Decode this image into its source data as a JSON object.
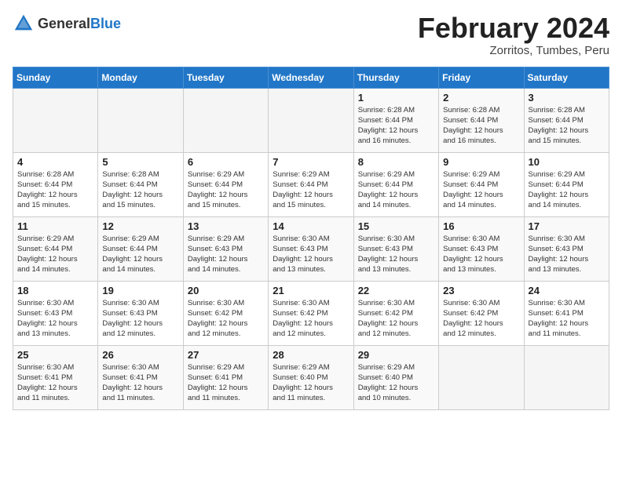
{
  "header": {
    "logo_general": "General",
    "logo_blue": "Blue",
    "month_year": "February 2024",
    "location": "Zorritos, Tumbes, Peru"
  },
  "weekdays": [
    "Sunday",
    "Monday",
    "Tuesday",
    "Wednesday",
    "Thursday",
    "Friday",
    "Saturday"
  ],
  "weeks": [
    [
      {
        "day": "",
        "info": ""
      },
      {
        "day": "",
        "info": ""
      },
      {
        "day": "",
        "info": ""
      },
      {
        "day": "",
        "info": ""
      },
      {
        "day": "1",
        "info": "Sunrise: 6:28 AM\nSunset: 6:44 PM\nDaylight: 12 hours\nand 16 minutes."
      },
      {
        "day": "2",
        "info": "Sunrise: 6:28 AM\nSunset: 6:44 PM\nDaylight: 12 hours\nand 16 minutes."
      },
      {
        "day": "3",
        "info": "Sunrise: 6:28 AM\nSunset: 6:44 PM\nDaylight: 12 hours\nand 15 minutes."
      }
    ],
    [
      {
        "day": "4",
        "info": "Sunrise: 6:28 AM\nSunset: 6:44 PM\nDaylight: 12 hours\nand 15 minutes."
      },
      {
        "day": "5",
        "info": "Sunrise: 6:28 AM\nSunset: 6:44 PM\nDaylight: 12 hours\nand 15 minutes."
      },
      {
        "day": "6",
        "info": "Sunrise: 6:29 AM\nSunset: 6:44 PM\nDaylight: 12 hours\nand 15 minutes."
      },
      {
        "day": "7",
        "info": "Sunrise: 6:29 AM\nSunset: 6:44 PM\nDaylight: 12 hours\nand 15 minutes."
      },
      {
        "day": "8",
        "info": "Sunrise: 6:29 AM\nSunset: 6:44 PM\nDaylight: 12 hours\nand 14 minutes."
      },
      {
        "day": "9",
        "info": "Sunrise: 6:29 AM\nSunset: 6:44 PM\nDaylight: 12 hours\nand 14 minutes."
      },
      {
        "day": "10",
        "info": "Sunrise: 6:29 AM\nSunset: 6:44 PM\nDaylight: 12 hours\nand 14 minutes."
      }
    ],
    [
      {
        "day": "11",
        "info": "Sunrise: 6:29 AM\nSunset: 6:44 PM\nDaylight: 12 hours\nand 14 minutes."
      },
      {
        "day": "12",
        "info": "Sunrise: 6:29 AM\nSunset: 6:44 PM\nDaylight: 12 hours\nand 14 minutes."
      },
      {
        "day": "13",
        "info": "Sunrise: 6:29 AM\nSunset: 6:43 PM\nDaylight: 12 hours\nand 14 minutes."
      },
      {
        "day": "14",
        "info": "Sunrise: 6:30 AM\nSunset: 6:43 PM\nDaylight: 12 hours\nand 13 minutes."
      },
      {
        "day": "15",
        "info": "Sunrise: 6:30 AM\nSunset: 6:43 PM\nDaylight: 12 hours\nand 13 minutes."
      },
      {
        "day": "16",
        "info": "Sunrise: 6:30 AM\nSunset: 6:43 PM\nDaylight: 12 hours\nand 13 minutes."
      },
      {
        "day": "17",
        "info": "Sunrise: 6:30 AM\nSunset: 6:43 PM\nDaylight: 12 hours\nand 13 minutes."
      }
    ],
    [
      {
        "day": "18",
        "info": "Sunrise: 6:30 AM\nSunset: 6:43 PM\nDaylight: 12 hours\nand 13 minutes."
      },
      {
        "day": "19",
        "info": "Sunrise: 6:30 AM\nSunset: 6:43 PM\nDaylight: 12 hours\nand 12 minutes."
      },
      {
        "day": "20",
        "info": "Sunrise: 6:30 AM\nSunset: 6:42 PM\nDaylight: 12 hours\nand 12 minutes."
      },
      {
        "day": "21",
        "info": "Sunrise: 6:30 AM\nSunset: 6:42 PM\nDaylight: 12 hours\nand 12 minutes."
      },
      {
        "day": "22",
        "info": "Sunrise: 6:30 AM\nSunset: 6:42 PM\nDaylight: 12 hours\nand 12 minutes."
      },
      {
        "day": "23",
        "info": "Sunrise: 6:30 AM\nSunset: 6:42 PM\nDaylight: 12 hours\nand 12 minutes."
      },
      {
        "day": "24",
        "info": "Sunrise: 6:30 AM\nSunset: 6:41 PM\nDaylight: 12 hours\nand 11 minutes."
      }
    ],
    [
      {
        "day": "25",
        "info": "Sunrise: 6:30 AM\nSunset: 6:41 PM\nDaylight: 12 hours\nand 11 minutes."
      },
      {
        "day": "26",
        "info": "Sunrise: 6:30 AM\nSunset: 6:41 PM\nDaylight: 12 hours\nand 11 minutes."
      },
      {
        "day": "27",
        "info": "Sunrise: 6:29 AM\nSunset: 6:41 PM\nDaylight: 12 hours\nand 11 minutes."
      },
      {
        "day": "28",
        "info": "Sunrise: 6:29 AM\nSunset: 6:40 PM\nDaylight: 12 hours\nand 11 minutes."
      },
      {
        "day": "29",
        "info": "Sunrise: 6:29 AM\nSunset: 6:40 PM\nDaylight: 12 hours\nand 10 minutes."
      },
      {
        "day": "",
        "info": ""
      },
      {
        "day": "",
        "info": ""
      }
    ]
  ]
}
